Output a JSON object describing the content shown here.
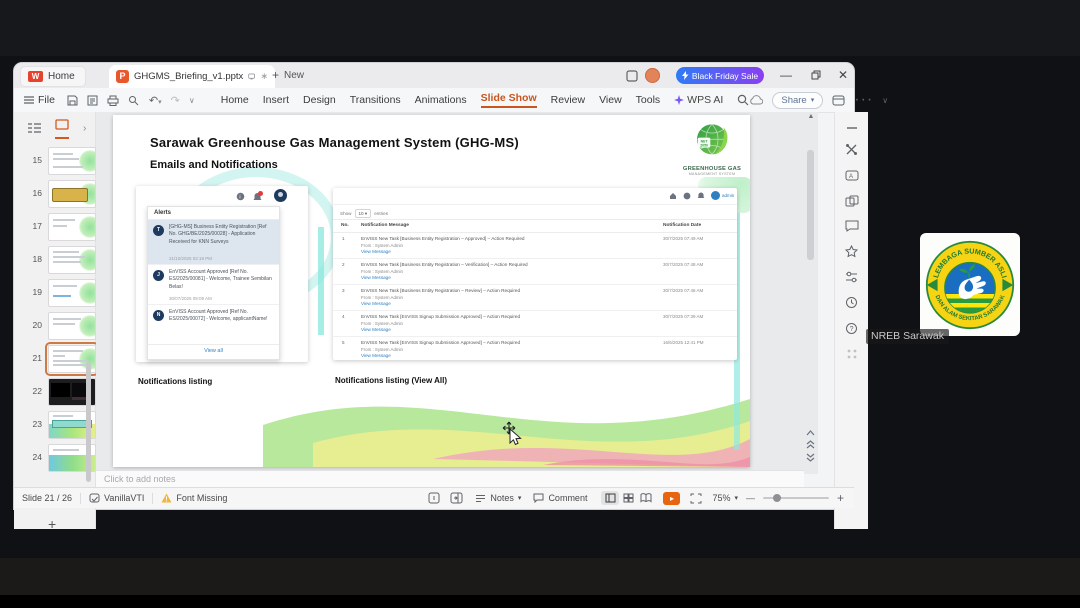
{
  "window": {
    "tabs": {
      "home": "Home",
      "doc": "GHGMS_Briefing_v1.pptx",
      "unsaved_marker": "∗",
      "new_label": "New"
    },
    "sale_button": "Black Friday Sale",
    "menu": {
      "file": "File",
      "items": [
        "Home",
        "Insert",
        "Design",
        "Transitions",
        "Animations",
        "Slide Show",
        "Review",
        "View",
        "Tools",
        "WPS AI"
      ]
    },
    "share": "Share"
  },
  "panel": {
    "slides": [
      "15",
      "16",
      "17",
      "18",
      "19",
      "20",
      "21",
      "22",
      "23",
      "24"
    ]
  },
  "slide": {
    "title": "Sarawak Greenhouse Gas Management System (GHG-MS)",
    "subtitle": "Emails and Notifications",
    "logo": {
      "line1": "GREENHOUSE GAS",
      "line2": "MANAGEMENT SYSTEM",
      "badge": "NET ZERO 2050"
    },
    "alerts": {
      "header": "Alerts",
      "view_all": "View all",
      "items": [
        {
          "initial": "T",
          "text": "[GHG-MS] Business Entity Registration [Ref No. GHG/BE/2025/00028] - Application Received for KNN Surveys",
          "time": "21/10/2025 02:19 PM"
        },
        {
          "initial": "J",
          "text": "EnVISS Account Approved [Ref No. ES/2025/00081] - Welcome, Trainee Sembilan Belas!",
          "time": "30/07/2025 09:09 AM"
        },
        {
          "initial": "N",
          "text": "EnVISS Account Approved [Ref No. ES/2025/00072] - Welcome, applicantName!",
          "time": ""
        }
      ]
    },
    "table": {
      "show": "Show",
      "show_value": "10",
      "entries": "entries",
      "user": "admin",
      "headers": [
        "No.",
        "Notification Message",
        "Notification Date"
      ],
      "rows": [
        {
          "no": "1",
          "message": "EnVISS New Task [Business Entity Registration – Approved] – Action Required",
          "from": "From : System Admin",
          "link": "View Message",
          "date": "30/7/2025 07:49 AM"
        },
        {
          "no": "2",
          "message": "EnVISS New Task [Business Entity Registration – Verification] – Action Required",
          "from": "From : System Admin",
          "link": "View Message",
          "date": "30/7/2025 07:48 AM"
        },
        {
          "no": "3",
          "message": "EnVISS New Task [Business Entity Registration – Review] – Action Required",
          "from": "From : System Admin",
          "link": "View Message",
          "date": "30/7/2025 07:46 AM"
        },
        {
          "no": "4",
          "message": "EnVISS New Task [EnVISS Signup Submission Approved] – Action Required",
          "from": "From : System Admin",
          "link": "View Message",
          "date": "30/7/2025 07:39 AM"
        },
        {
          "no": "5",
          "message": "EnVISS New Task [EnVISS Signup Submission Approved] – Action Required",
          "from": "From : System Admin",
          "link": "View Message",
          "date": "16/6/2025 12:41 PM"
        }
      ]
    },
    "captions": {
      "left": "Notifications listing",
      "right": "Notifications listing (View All)"
    }
  },
  "notes_placeholder": "Click to add notes",
  "statusbar": {
    "slide_indicator": "Slide 21 / 26",
    "language": "VanillaVTI",
    "font_missing": "Font Missing",
    "notes": "Notes",
    "comment": "Comment",
    "zoom": "75%"
  },
  "meeting": {
    "participant": "NREB Sarawak",
    "logo_arc_top": "LEMBAGA SUMBER ASLI",
    "logo_arc_bottom": "DAN ALAM SEKITAR SARAWAK"
  },
  "colors": {
    "accent_orange": "#c9561f",
    "sale_from": "#2f7bf6",
    "sale_to": "#8a3ff0",
    "link_blue": "#2f7fc1",
    "play_orange": "#e8650f"
  }
}
